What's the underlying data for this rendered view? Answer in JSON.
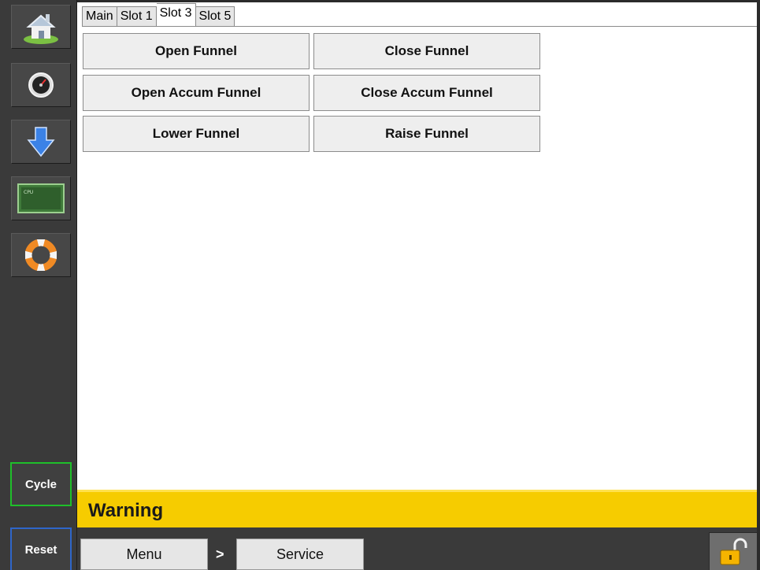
{
  "tabs": [
    {
      "label": "Main",
      "active": false
    },
    {
      "label": "Slot 1",
      "active": false
    },
    {
      "label": "Slot 3",
      "active": true
    },
    {
      "label": "Slot 5",
      "active": false
    }
  ],
  "sidebar": {
    "icons": [
      "home-icon",
      "gauge-icon",
      "download-arrow-icon",
      "cpu-chip-icon",
      "lifebuoy-icon"
    ],
    "cpu_chip_text": "CPU"
  },
  "commands": {
    "open_funnel": "Open Funnel",
    "close_funnel": "Close Funnel",
    "open_accum_funnel": "Open Accum Funnel",
    "close_accum_funnel": "Close Accum Funnel",
    "lower_funnel": "Lower Funnel",
    "raise_funnel": "Raise Funnel"
  },
  "controls": {
    "cycle": "Cycle",
    "reset": "Reset"
  },
  "status": {
    "message": "Warning",
    "color": "#f6cc00"
  },
  "breadcrumb": {
    "menu": "Menu",
    "separator": ">",
    "current": "Service"
  },
  "colors": {
    "cycle_border": "#1fbf2a",
    "reset_border": "#2f66c9",
    "sidebar": "#3a3a3a"
  }
}
